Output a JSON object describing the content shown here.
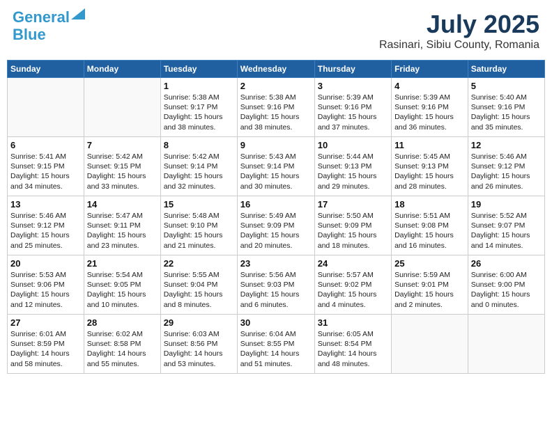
{
  "header": {
    "logo_line1": "General",
    "logo_line2": "Blue",
    "month": "July 2025",
    "location": "Rasinari, Sibiu County, Romania"
  },
  "days_of_week": [
    "Sunday",
    "Monday",
    "Tuesday",
    "Wednesday",
    "Thursday",
    "Friday",
    "Saturday"
  ],
  "weeks": [
    [
      {
        "day": "",
        "content": ""
      },
      {
        "day": "",
        "content": ""
      },
      {
        "day": "1",
        "content": "Sunrise: 5:38 AM\nSunset: 9:17 PM\nDaylight: 15 hours and 38 minutes."
      },
      {
        "day": "2",
        "content": "Sunrise: 5:38 AM\nSunset: 9:16 PM\nDaylight: 15 hours and 38 minutes."
      },
      {
        "day": "3",
        "content": "Sunrise: 5:39 AM\nSunset: 9:16 PM\nDaylight: 15 hours and 37 minutes."
      },
      {
        "day": "4",
        "content": "Sunrise: 5:39 AM\nSunset: 9:16 PM\nDaylight: 15 hours and 36 minutes."
      },
      {
        "day": "5",
        "content": "Sunrise: 5:40 AM\nSunset: 9:16 PM\nDaylight: 15 hours and 35 minutes."
      }
    ],
    [
      {
        "day": "6",
        "content": "Sunrise: 5:41 AM\nSunset: 9:15 PM\nDaylight: 15 hours and 34 minutes."
      },
      {
        "day": "7",
        "content": "Sunrise: 5:42 AM\nSunset: 9:15 PM\nDaylight: 15 hours and 33 minutes."
      },
      {
        "day": "8",
        "content": "Sunrise: 5:42 AM\nSunset: 9:14 PM\nDaylight: 15 hours and 32 minutes."
      },
      {
        "day": "9",
        "content": "Sunrise: 5:43 AM\nSunset: 9:14 PM\nDaylight: 15 hours and 30 minutes."
      },
      {
        "day": "10",
        "content": "Sunrise: 5:44 AM\nSunset: 9:13 PM\nDaylight: 15 hours and 29 minutes."
      },
      {
        "day": "11",
        "content": "Sunrise: 5:45 AM\nSunset: 9:13 PM\nDaylight: 15 hours and 28 minutes."
      },
      {
        "day": "12",
        "content": "Sunrise: 5:46 AM\nSunset: 9:12 PM\nDaylight: 15 hours and 26 minutes."
      }
    ],
    [
      {
        "day": "13",
        "content": "Sunrise: 5:46 AM\nSunset: 9:12 PM\nDaylight: 15 hours and 25 minutes."
      },
      {
        "day": "14",
        "content": "Sunrise: 5:47 AM\nSunset: 9:11 PM\nDaylight: 15 hours and 23 minutes."
      },
      {
        "day": "15",
        "content": "Sunrise: 5:48 AM\nSunset: 9:10 PM\nDaylight: 15 hours and 21 minutes."
      },
      {
        "day": "16",
        "content": "Sunrise: 5:49 AM\nSunset: 9:09 PM\nDaylight: 15 hours and 20 minutes."
      },
      {
        "day": "17",
        "content": "Sunrise: 5:50 AM\nSunset: 9:09 PM\nDaylight: 15 hours and 18 minutes."
      },
      {
        "day": "18",
        "content": "Sunrise: 5:51 AM\nSunset: 9:08 PM\nDaylight: 15 hours and 16 minutes."
      },
      {
        "day": "19",
        "content": "Sunrise: 5:52 AM\nSunset: 9:07 PM\nDaylight: 15 hours and 14 minutes."
      }
    ],
    [
      {
        "day": "20",
        "content": "Sunrise: 5:53 AM\nSunset: 9:06 PM\nDaylight: 15 hours and 12 minutes."
      },
      {
        "day": "21",
        "content": "Sunrise: 5:54 AM\nSunset: 9:05 PM\nDaylight: 15 hours and 10 minutes."
      },
      {
        "day": "22",
        "content": "Sunrise: 5:55 AM\nSunset: 9:04 PM\nDaylight: 15 hours and 8 minutes."
      },
      {
        "day": "23",
        "content": "Sunrise: 5:56 AM\nSunset: 9:03 PM\nDaylight: 15 hours and 6 minutes."
      },
      {
        "day": "24",
        "content": "Sunrise: 5:57 AM\nSunset: 9:02 PM\nDaylight: 15 hours and 4 minutes."
      },
      {
        "day": "25",
        "content": "Sunrise: 5:59 AM\nSunset: 9:01 PM\nDaylight: 15 hours and 2 minutes."
      },
      {
        "day": "26",
        "content": "Sunrise: 6:00 AM\nSunset: 9:00 PM\nDaylight: 15 hours and 0 minutes."
      }
    ],
    [
      {
        "day": "27",
        "content": "Sunrise: 6:01 AM\nSunset: 8:59 PM\nDaylight: 14 hours and 58 minutes."
      },
      {
        "day": "28",
        "content": "Sunrise: 6:02 AM\nSunset: 8:58 PM\nDaylight: 14 hours and 55 minutes."
      },
      {
        "day": "29",
        "content": "Sunrise: 6:03 AM\nSunset: 8:56 PM\nDaylight: 14 hours and 53 minutes."
      },
      {
        "day": "30",
        "content": "Sunrise: 6:04 AM\nSunset: 8:55 PM\nDaylight: 14 hours and 51 minutes."
      },
      {
        "day": "31",
        "content": "Sunrise: 6:05 AM\nSunset: 8:54 PM\nDaylight: 14 hours and 48 minutes."
      },
      {
        "day": "",
        "content": ""
      },
      {
        "day": "",
        "content": ""
      }
    ]
  ]
}
